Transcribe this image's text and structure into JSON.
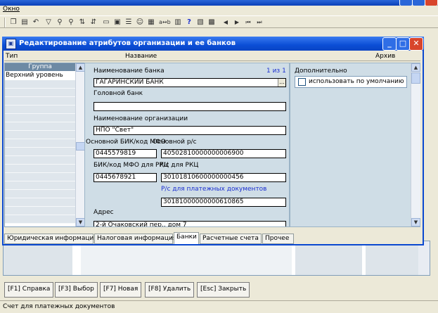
{
  "menubar": {
    "window": "Окно"
  },
  "dialog": {
    "title": "Редактирование атрибутов организации и ее банков",
    "columns": {
      "type": "Тип",
      "name": "Название",
      "archive": "Архив"
    }
  },
  "left_list": {
    "header": "Группа",
    "selected": "Верхний уровень"
  },
  "form": {
    "bank_name_label": "Наименование банка",
    "counter": "1 из 1",
    "bank_name_value": "ГАГАРИНСКИЙ БАНК",
    "head_bank_label": "Головной банк",
    "head_bank_value": "",
    "org_name_label": "Наименование организации",
    "org_name_value": "НПО \"Свет\"",
    "bik_label": "Основной БИК/код МФО",
    "main_account_label": "Основной р/с",
    "bik_value": "0445579819",
    "main_account_value": "40502810000000006900",
    "rkc_bik_label": "БИК/код МФО для РКЦ",
    "rkc_account_label": "Р/с для РКЦ",
    "rkc_bik_value": "0445678921",
    "rkc_account_value": "30101810600000000456",
    "payment_docs_label": "Р/с для платежных документов",
    "payment_docs_value": "30181000000000610865",
    "address_label": "Адрес",
    "address_value": "2-й Очаковский пер., дом 7"
  },
  "additional": {
    "label": "Дополнительно",
    "use_default_label": "использовать по умолчанию"
  },
  "tabs": [
    {
      "label": "Юридическая информация"
    },
    {
      "label": "Налоговая информация"
    },
    {
      "label": "Банки"
    },
    {
      "label": "Расчетные счета"
    },
    {
      "label": "Прочее"
    }
  ],
  "fkeys": [
    {
      "label": "[F1] Справка"
    },
    {
      "label": "[F3] Выбор"
    },
    {
      "label": "[F7] Новая"
    },
    {
      "label": "[F8] Удалить"
    },
    {
      "label": "[Esc] Закрыть"
    }
  ],
  "status": "Счет для платежных документов",
  "colors": {
    "title_blue": "#0b4ed6",
    "panel_bg": "#cfdde6",
    "link_blue": "#1a2ed0",
    "close_red": "#d8452c"
  }
}
